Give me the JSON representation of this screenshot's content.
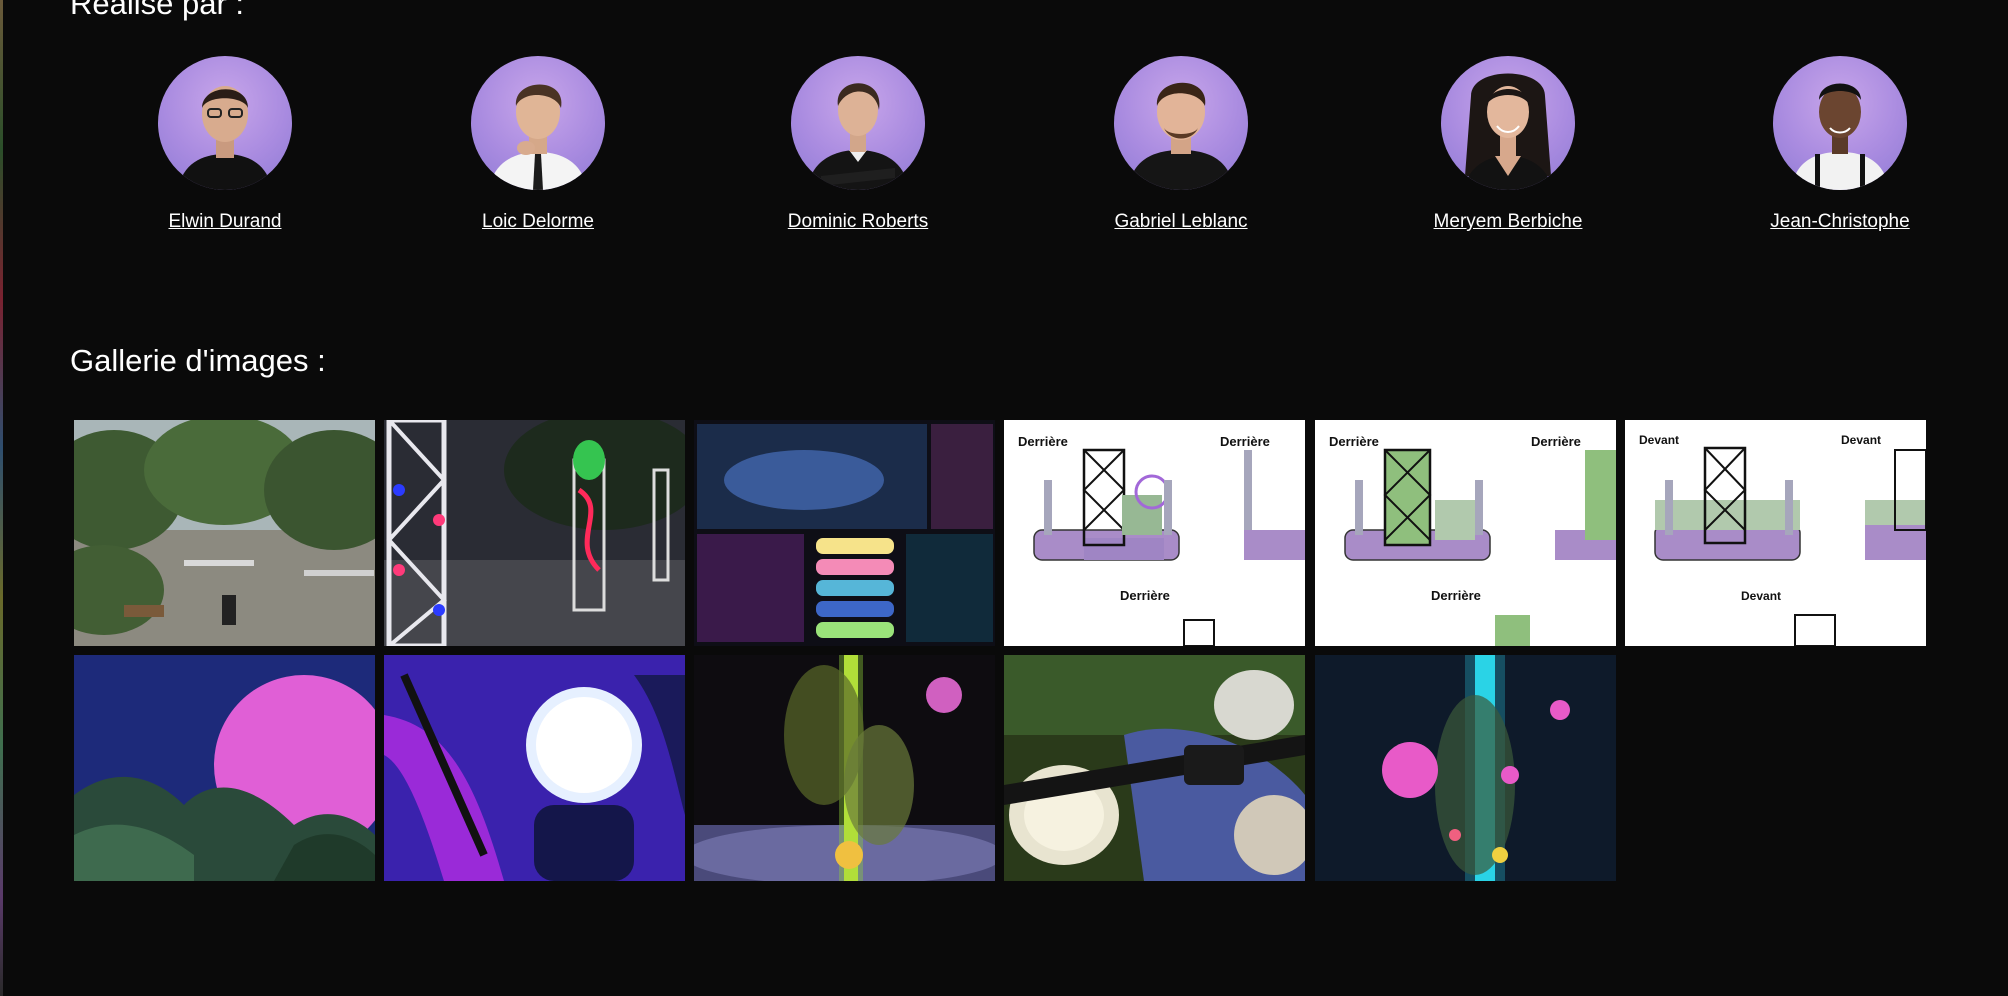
{
  "sections": {
    "credits_title": "Réalisé par :",
    "gallery_title": "Gallerie d'images :"
  },
  "team": [
    {
      "name": "Elwin Durand"
    },
    {
      "name": "Loic Delorme"
    },
    {
      "name": "Dominic Roberts"
    },
    {
      "name": "Gabriel Leblanc"
    },
    {
      "name": "Meryem Berbiche"
    },
    {
      "name": "Jean-Christophe"
    }
  ],
  "gallery": {
    "sketch_labels": {
      "back": "Derrière",
      "front": "Devant"
    }
  },
  "colors": {
    "background": "#0a0a0a",
    "text": "#ffffff",
    "avatar_backdrop": "#b196e4"
  }
}
